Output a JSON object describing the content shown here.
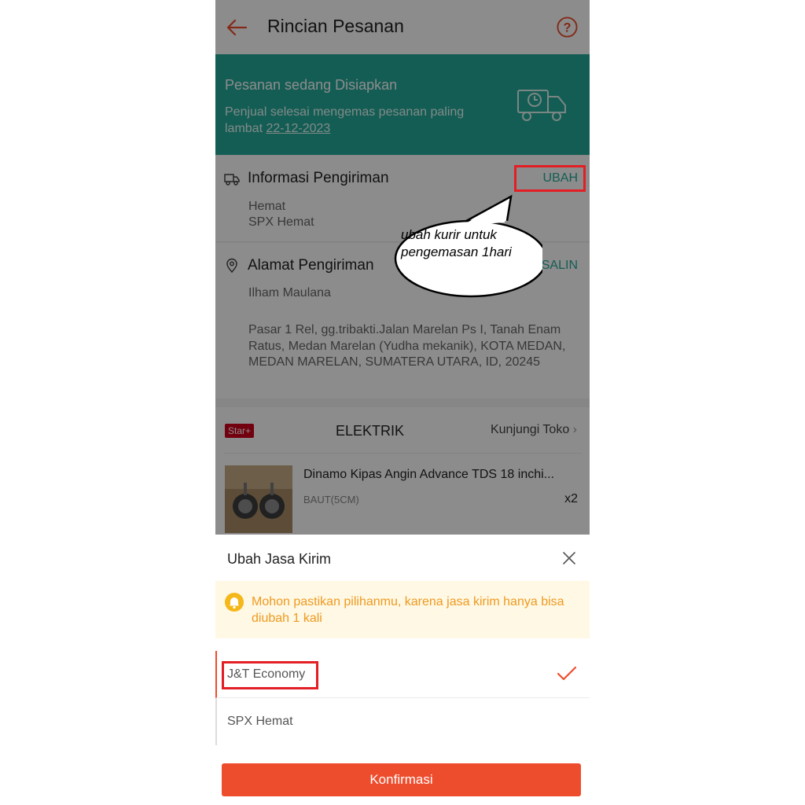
{
  "header": {
    "title": "Rincian Pesanan"
  },
  "status": {
    "title": "Pesanan sedang Disiapkan",
    "desc_prefix": "Penjual selesai mengemas pesanan paling lambat ",
    "date": "22-12-2023"
  },
  "shipping": {
    "title": "Informasi Pengiriman",
    "action": "UBAH",
    "service": "Hemat",
    "courier": "SPX Hemat"
  },
  "address": {
    "title": "Alamat Pengiriman",
    "action": "SALIN",
    "name": "Ilham Maulana",
    "full": "Pasar 1 Rel, gg.tribakti.Jalan Marelan Ps I, Tanah Enam Ratus, Medan Marelan (Yudha mekanik), KOTA MEDAN, MEDAN MARELAN, SUMATERA UTARA, ID, 20245"
  },
  "shop": {
    "badge": "Star+",
    "name": "ELEKTRIK",
    "visit": "Kunjungi Toko",
    "product": {
      "name": "Dinamo Kipas Angin Advance TDS 18 inchi...",
      "variant": "BAUT(5CM)",
      "qty": "x2"
    }
  },
  "sheet": {
    "title": "Ubah Jasa Kirim",
    "warning": "Mohon pastikan pilihanmu, karena jasa kirim hanya bisa diubah 1 kali",
    "options": [
      {
        "label": "J&T Economy",
        "selected": true
      },
      {
        "label": "SPX Hemat",
        "selected": false
      }
    ],
    "confirm": "Konfirmasi"
  },
  "annotation": {
    "text": "ubah kurir untuk pengemasan 1hari"
  },
  "colors": {
    "primary": "#ee4d2d",
    "teal": "#26aa99",
    "warning": "#ee9a21",
    "highlight": "#e31e24"
  }
}
